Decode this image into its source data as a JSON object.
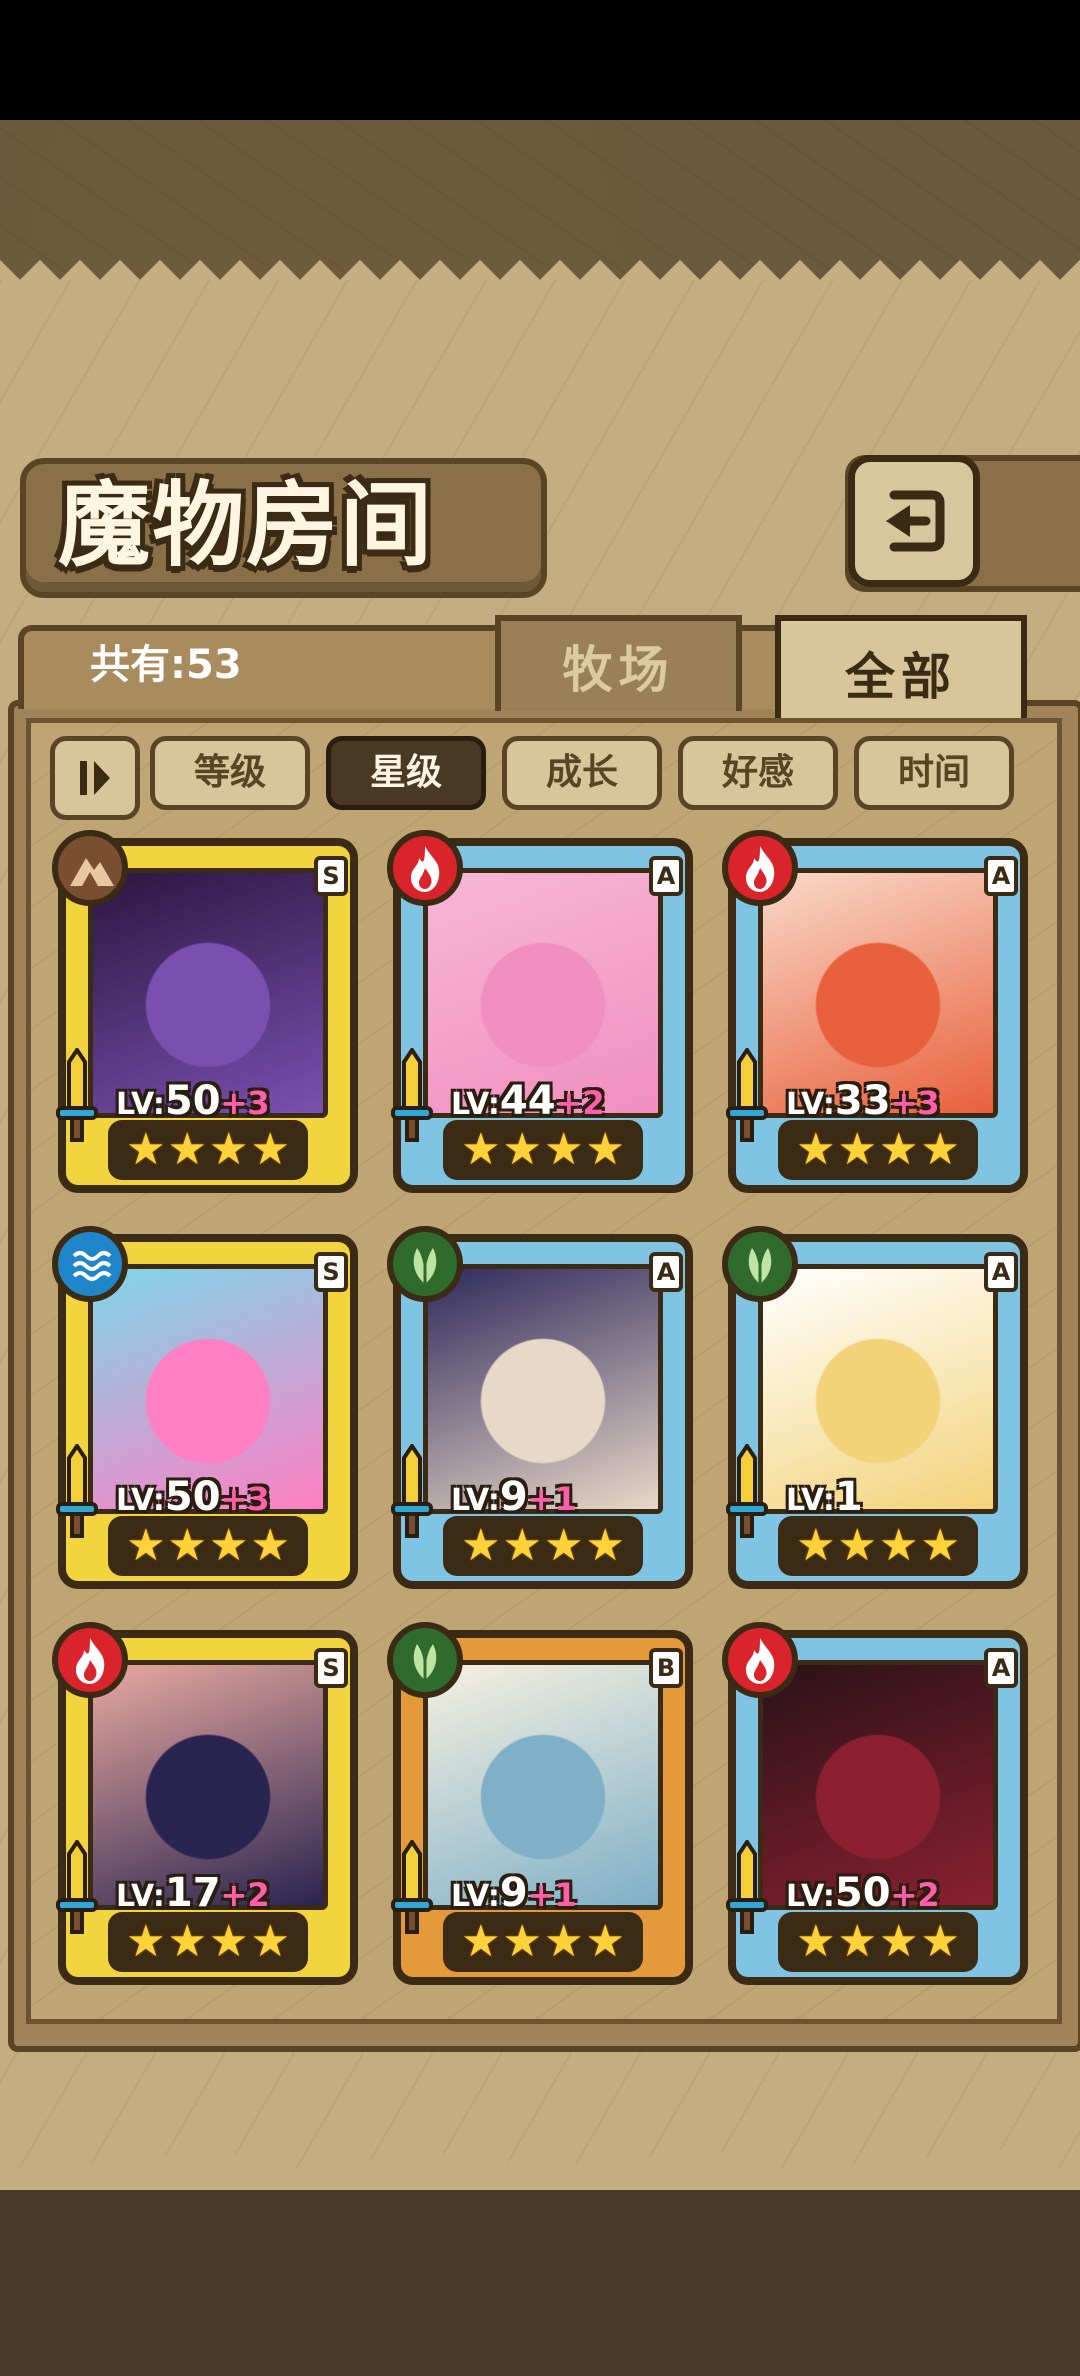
{
  "title": "魔物房间",
  "total": "共有:53",
  "tabs": [
    {
      "label": "牧场",
      "active": false
    },
    {
      "label": "全部",
      "active": true
    }
  ],
  "sort_buttons": [
    {
      "label": "等级",
      "active": false
    },
    {
      "label": "星级",
      "active": true
    },
    {
      "label": "成长",
      "active": false
    },
    {
      "label": "好感",
      "active": false
    },
    {
      "label": "时间",
      "active": false
    }
  ],
  "monsters": [
    {
      "rank": "S",
      "element": "earth",
      "level": "50",
      "bonus": "+3",
      "stars": 4,
      "art_colors": [
        "#2a1740",
        "#7b4fb0"
      ]
    },
    {
      "rank": "A",
      "element": "fire",
      "level": "44",
      "bonus": "+2",
      "stars": 4,
      "art_colors": [
        "#f7b7d6",
        "#f18fbf"
      ]
    },
    {
      "rank": "A",
      "element": "fire",
      "level": "33",
      "bonus": "+3",
      "stars": 4,
      "art_colors": [
        "#f9d9c8",
        "#e9603c"
      ]
    },
    {
      "rank": "S",
      "element": "water",
      "level": "50",
      "bonus": "+3",
      "stars": 4,
      "art_colors": [
        "#7fd6e8",
        "#ff7fc4"
      ]
    },
    {
      "rank": "A",
      "element": "grass",
      "level": "9",
      "bonus": "+1",
      "stars": 4,
      "art_colors": [
        "#2f2a5c",
        "#e8d8c8"
      ]
    },
    {
      "rank": "A",
      "element": "grass",
      "level": "1",
      "bonus": "",
      "stars": 4,
      "art_colors": [
        "#ffffff",
        "#f3d37a"
      ]
    },
    {
      "rank": "S",
      "element": "fire",
      "level": "17",
      "bonus": "+2",
      "stars": 4,
      "art_colors": [
        "#e8a9a0",
        "#2a2450"
      ]
    },
    {
      "rank": "B",
      "element": "grass",
      "level": "9",
      "bonus": "+1",
      "stars": 4,
      "art_colors": [
        "#f6f0e0",
        "#7fb0c8"
      ]
    },
    {
      "rank": "A",
      "element": "fire",
      "level": "50",
      "bonus": "+2",
      "stars": 4,
      "art_colors": [
        "#2a1218",
        "#8a2030"
      ]
    }
  ]
}
